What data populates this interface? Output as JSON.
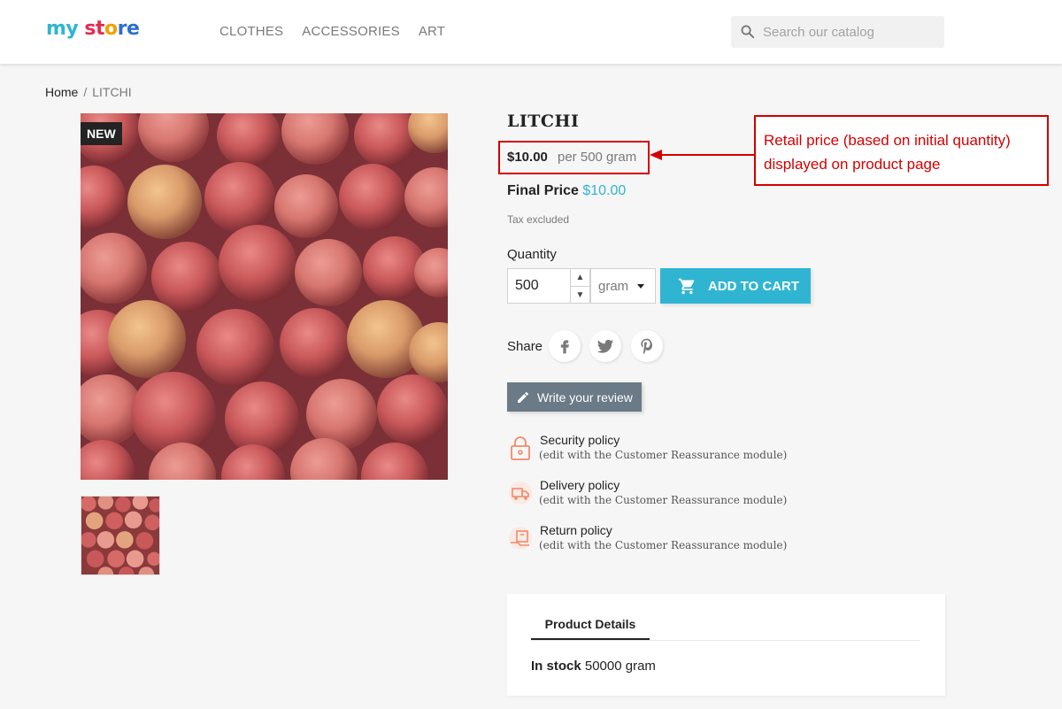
{
  "header": {
    "logo": {
      "part1": "my",
      "part2": " st",
      "part3": "o",
      "part4": "re"
    },
    "nav": [
      "CLOTHES",
      "ACCESSORIES",
      "ART"
    ],
    "search_placeholder": "Search our catalog"
  },
  "breadcrumb": {
    "home": "Home",
    "separator": "/",
    "current": "LITCHI"
  },
  "product": {
    "badge": "NEW",
    "title": "LITCHI",
    "price": "$10.00",
    "per_unit": "per 500 gram",
    "final_label": "Final Price",
    "final_value": "$10.00",
    "tax_note": "Tax excluded",
    "quantity_label": "Quantity",
    "quantity_value": "500",
    "unit": "gram",
    "add_to_cart": "ADD TO CART",
    "share_label": "Share",
    "social": [
      "f",
      "t",
      "p"
    ],
    "review_button": "Write your review"
  },
  "reassurance": [
    {
      "title": "Security policy",
      "subtitle": "(edit with the Customer Reassurance module)",
      "icon": "lock-icon"
    },
    {
      "title": "Delivery policy",
      "subtitle": "(edit with the Customer Reassurance module)",
      "icon": "truck-icon"
    },
    {
      "title": "Return policy",
      "subtitle": "(edit with the Customer Reassurance module)",
      "icon": "return-box-icon"
    }
  ],
  "annotation": {
    "line1": "Retail price (based on initial quantity)",
    "line2": "displayed on product page"
  },
  "tabs": {
    "active": "Product Details",
    "stock_label": "In stock",
    "stock_value": "50000 gram"
  },
  "colors": {
    "accent": "#2fb5d2",
    "annotation": "#d40000",
    "review_button": "#6a7a86"
  }
}
